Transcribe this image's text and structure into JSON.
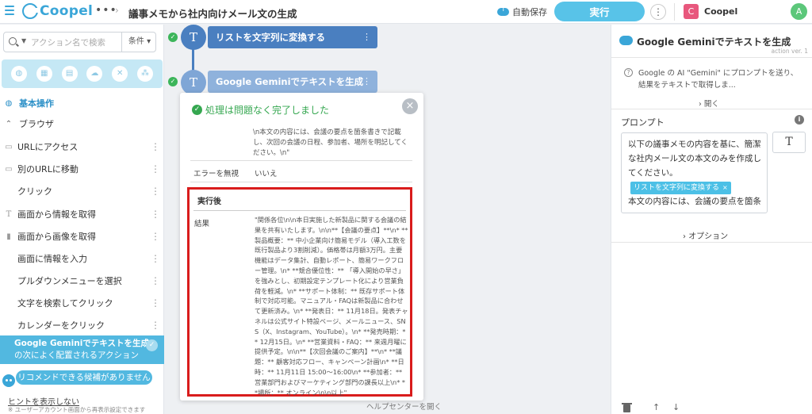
{
  "app": {
    "logo_text": "Coopel",
    "title": "議事メモから社内向けメール文の生成",
    "autosave_label": "自動保存",
    "run_label": "実行",
    "workspace_initial": "C",
    "workspace_name": "Coopel",
    "user_initial": "A"
  },
  "sidebar": {
    "search_placeholder": "アクション名で検索",
    "condition_label": "条件",
    "section_basic": "基本操作",
    "section_browser": "ブラウザ",
    "items": [
      {
        "label": "URLにアクセス",
        "icon": "window"
      },
      {
        "label": "別のURLに移動",
        "icon": "window"
      },
      {
        "label": "クリック",
        "icon": ""
      },
      {
        "label": "画面から情報を取得",
        "icon": "T"
      },
      {
        "label": "画面から画像を取得",
        "icon": "doc"
      },
      {
        "label": "画面に情報を入力",
        "icon": ""
      },
      {
        "label": "プルダウンメニューを選択",
        "icon": ""
      },
      {
        "label": "文字を検索してクリック",
        "icon": ""
      },
      {
        "label": "カレンダーをクリック",
        "icon": ""
      }
    ],
    "recommend_line1": "Google Geminiでテキストを生成",
    "recommend_line2": "の次によく配置されるアクション",
    "recommend_bubble": "リコメンドできる候補がありません",
    "hint_link": "ヒントを表示しない",
    "hint_note": "※ ユーザーアカウント画面から再表示設定できます"
  },
  "canvas": {
    "node1_label": "リストを文字列に変換する",
    "node2_label": "Google Geminiでテキストを生成",
    "help_center": "ヘルプセンターを開く"
  },
  "popup": {
    "status": "処理は問題なく完了しました",
    "prev_text": "\\n本文の内容には、会議の要点を箇条書きで記載し、次回の会議の日程、参加者、場所を明記してください。\\n\"",
    "ignore_label": "エラーを無視",
    "ignore_value": "いいえ",
    "after_title": "実行後",
    "result_label": "結果",
    "result_text": "\"関係各位\\n\\n本日実施した新製品に関する会議の結果を共有いたします。\\n\\n**【会議の要点】**\\n* **製品概要：** 中小企業向け簡易モデル（導入工数を既行製品より3割削減）。価格帯は月額3万円。主要機能はデータ集計、自動レポート、簡易ワークフロー管理。\\n* **競合優位性：** 「導入開始の早さ」を強みとし、初期設定テンプレート化により営業負荷を軽減。\\n* **サポート体制：** 既存サポート体制で対応可能。マニュアル・FAQは新製品に合わせて更新済み。\\n* **発表日：** 11月18日。発表チャネルは公式サイト特設ページ、メールニュース、SNS（X、Instagram、YouTube）。\\n* **発売時期：** 12月15日。\\n* **営業資料・FAQ：** 来週月曜に提供予定。\\n\\n**【次回会議のご案内】**\\n* **議題：** 顧客対応フロー、キャンペーン計画\\n* **日時：** 11月11日 15:00〜16:00\\n* **参加者：** 営業部門およびマーケティング部門の課長以上\\n* **場所：** オンライン\\n\\n以上\""
  },
  "right_panel": {
    "title": "Google Geminiでテキストを生成",
    "version": "action ver. 1",
    "desc": "Google の AI \"Gemini\" にプロンプトを送り、結果をテキストで取得しま...",
    "open_label": "開く",
    "prompt_label": "プロンプト",
    "prompt_line1": "以下の議事メモの内容を基に、簡潔な社内メール文の本文のみを作成してください。",
    "chip_label": "リストを文字列に変換する",
    "prompt_line2": "本文の内容には、会議の要点を箇条",
    "options_label": "オプション",
    "T_button": "T"
  },
  "colors": {
    "brand": "#3aa6d8",
    "run_button": "#58c3e8",
    "node": "#4a7fc0",
    "success": "#35a750",
    "highlight_border": "#d91c1c"
  }
}
